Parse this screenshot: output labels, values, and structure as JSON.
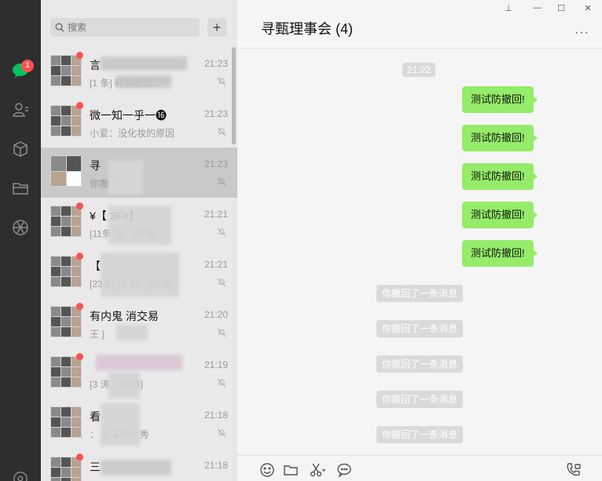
{
  "rail": {
    "unread_count": "1"
  },
  "search": {
    "placeholder": "搜索",
    "add_label": "+"
  },
  "conversations": [
    {
      "name": "言",
      "time": "21:23",
      "preview": "[1 条] 韩美家居..."
    },
    {
      "name": "微一知一乎一⓰",
      "time": "21:23",
      "preview": "小爱：没化妆的原因"
    },
    {
      "name": "寻",
      "time": "21:23",
      "preview": "你撤 息"
    },
    {
      "name": "¥【 3F#】...",
      "time": "21:21",
      "preview": "[11条 路：[链接]"
    },
    {
      "name": "【",
      "time": "21:21",
      "preview": "[23条] 行 路：[链接]"
    },
    {
      "name": "有内鬼 消交易",
      "time": "21:20",
      "preview": "王 ]"
    },
    {
      "name": "",
      "time": "21:19",
      "preview": "[3 涛：[视频]"
    },
    {
      "name": "看",
      "time": "21:18",
      "preview": "： 我不够优秀"
    },
    {
      "name": "三",
      "time": "21:18",
      "preview": ""
    }
  ],
  "chat": {
    "title": "寻甄理事会 (4)",
    "time_chip": "21:22",
    "more": "···",
    "sent_messages": [
      "测试防撤回!",
      "测试防撤回!",
      "测试防撤回!",
      "测试防撤回!",
      "测试防撤回!"
    ],
    "recall_messages": [
      "你撤回了一条消息",
      "你撤回了一条消息",
      "你撤回了一条消息",
      "你撤回了一条消息",
      "你撤回了一条消息"
    ]
  },
  "window": {
    "pin": "⊥",
    "minimize": "—",
    "maximize": "☐",
    "close": "✕"
  },
  "colors": {
    "bubble": "#95ec69",
    "badge": "#fa5151",
    "rail": "#2e2e2e",
    "active_row": "#c9c9c9"
  }
}
